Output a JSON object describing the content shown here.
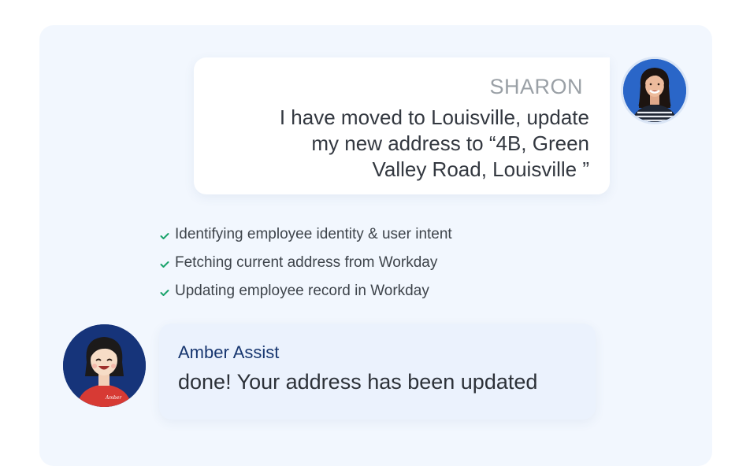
{
  "user_message": {
    "sender": "SHARON",
    "text_lines": [
      "I have moved to Louisville, update",
      "my new address to “4B, Green",
      "Valley Road, Louisville ”"
    ],
    "avatar": "woman-avatar"
  },
  "steps": [
    {
      "label": "Identifying employee identity & user intent",
      "icon": "check-icon",
      "status": "done"
    },
    {
      "label": "Fetching current address from Workday",
      "icon": "check-icon",
      "status": "done"
    },
    {
      "label": "Updating employee record in Workday",
      "icon": "check-icon",
      "status": "done"
    }
  ],
  "bot_message": {
    "sender": "Amber Assist",
    "text": "done! Your address has been updated",
    "avatar": "amber-avatar",
    "shirt_text": "Amber"
  },
  "colors": {
    "stage_bg": "#f2f7fe",
    "check": "#1aa36b",
    "bot_name": "#17366f",
    "user_name": "#9aa0a6",
    "avatar_bg_sharon": "#2a66c8",
    "avatar_bg_amber": "#16347a"
  }
}
